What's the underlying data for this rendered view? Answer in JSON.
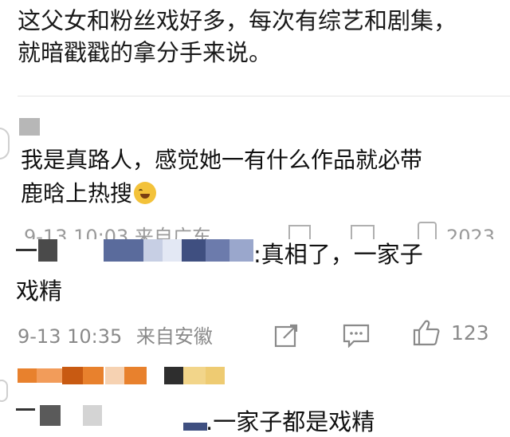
{
  "post": {
    "text_line1": "这父女和粉丝戏好多，每次有综艺和剧集，",
    "text_line2": "就暗戳戳的拿分手来说。"
  },
  "comment1": {
    "text_line1": "我是真路人，感觉她一有什么作品就必带",
    "text_line2": "鹿晗上热搜",
    "emoji": "laughing-crying-emoji",
    "meta_partial": "9-13 10:03 来自广东",
    "like_partial": "2023"
  },
  "comment2": {
    "text_line1": ":真相了，一家子",
    "text_line2": "戏精",
    "time": "9-13 10:35",
    "location": "来自安徽",
    "like_count": "123"
  },
  "comment3": {
    "text": ".一家子都是戏精"
  },
  "colors": {
    "mosaic_blue": "#5a6b9c",
    "mosaic_orange": "#e8812d",
    "icon_gray": "#8a8a8a"
  }
}
